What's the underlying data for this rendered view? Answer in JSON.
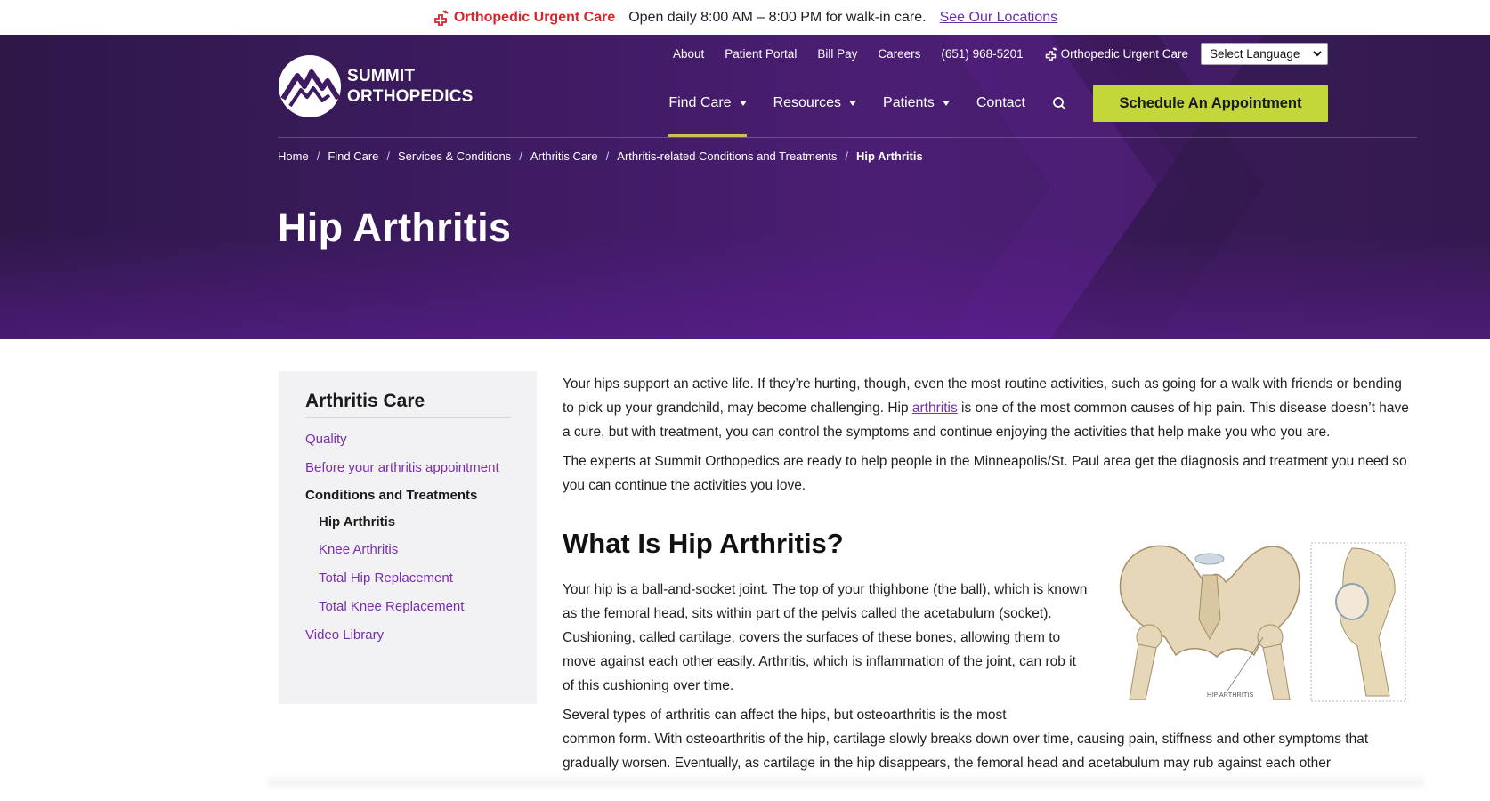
{
  "alert": {
    "title": "Orthopedic Urgent Care",
    "hours": "Open daily 8:00 AM – 8:00 PM for walk-in care.",
    "link": "See Our Locations",
    "color": "#d6262d"
  },
  "logo": {
    "line1": "SUMMIT",
    "line2": "ORTHOPEDICS"
  },
  "utility_nav": {
    "about": "About",
    "patient_portal": "Patient Portal",
    "bill_pay": "Bill Pay",
    "careers": "Careers",
    "phone": "(651) 968-5201",
    "urgent_care": "Orthopedic Urgent Care",
    "language": "Select Language"
  },
  "main_nav": {
    "find_care": "Find Care",
    "resources": "Resources",
    "patients": "Patients",
    "contact": "Contact",
    "cta": "Schedule An Appointment",
    "cta_color": "#c3d63a"
  },
  "breadcrumb": {
    "home": "Home",
    "find_care": "Find Care",
    "services": "Services & Conditions",
    "arthritis_care": "Arthritis Care",
    "related": "Arthritis-related Conditions and Treatments",
    "current": "Hip Arthritis"
  },
  "page": {
    "title": "Hip Arthritis"
  },
  "sidebar": {
    "title": "Arthritis Care",
    "quality": "Quality",
    "before": "Before your arthritis appointment",
    "conditions": "Conditions and Treatments",
    "hip": "Hip Arthritis",
    "knee": "Knee Arthritis",
    "hip_replacement": "Total Hip Replacement",
    "knee_replacement": "Total Knee Replacement",
    "video": "Video Library"
  },
  "content": {
    "p1_a": "Your hips support an active life. If they’re hurting, though, even the most routine activities, such as going for a walk with friends or bending to pick up your grandchild, may become challenging. Hip ",
    "p1_link": "arthritis",
    "p1_b": " is one of the most common causes of hip pain. This disease doesn’t have a cure, but with treatment, you can control the symptoms and continue enjoying the activities that help make you who you are.",
    "p2": "The experts at Summit Orthopedics are ready to help people in the Minneapolis/St. Paul area get the diagnosis and treatment you need so you can continue the activities you love.",
    "h2": "What Is Hip Arthritis?",
    "p3": "Your hip is a ball-and-socket joint. The top of your thighbone (the ball), which is known as the femoral head, sits within part of the pelvis called the acetabulum (socket). Cushioning, called cartilage, covers the surfaces of these bones, allowing them to move against each other easily. Arthritis, which is inflammation of the joint, can rob it of this cushioning over time.",
    "p4_a": "Several types of arthritis can affect the hips, but osteoarthritis is the most",
    "p4_b": "common form. With osteoarthritis of the hip, cartilage slowly breaks down over time, causing pain, stiffness and other symptoms that gradually worsen. Eventually, as cartilage in the hip disappears, the femoral head and acetabulum may rub against each other",
    "figure_caption": "HIP ARTHRITIS"
  }
}
